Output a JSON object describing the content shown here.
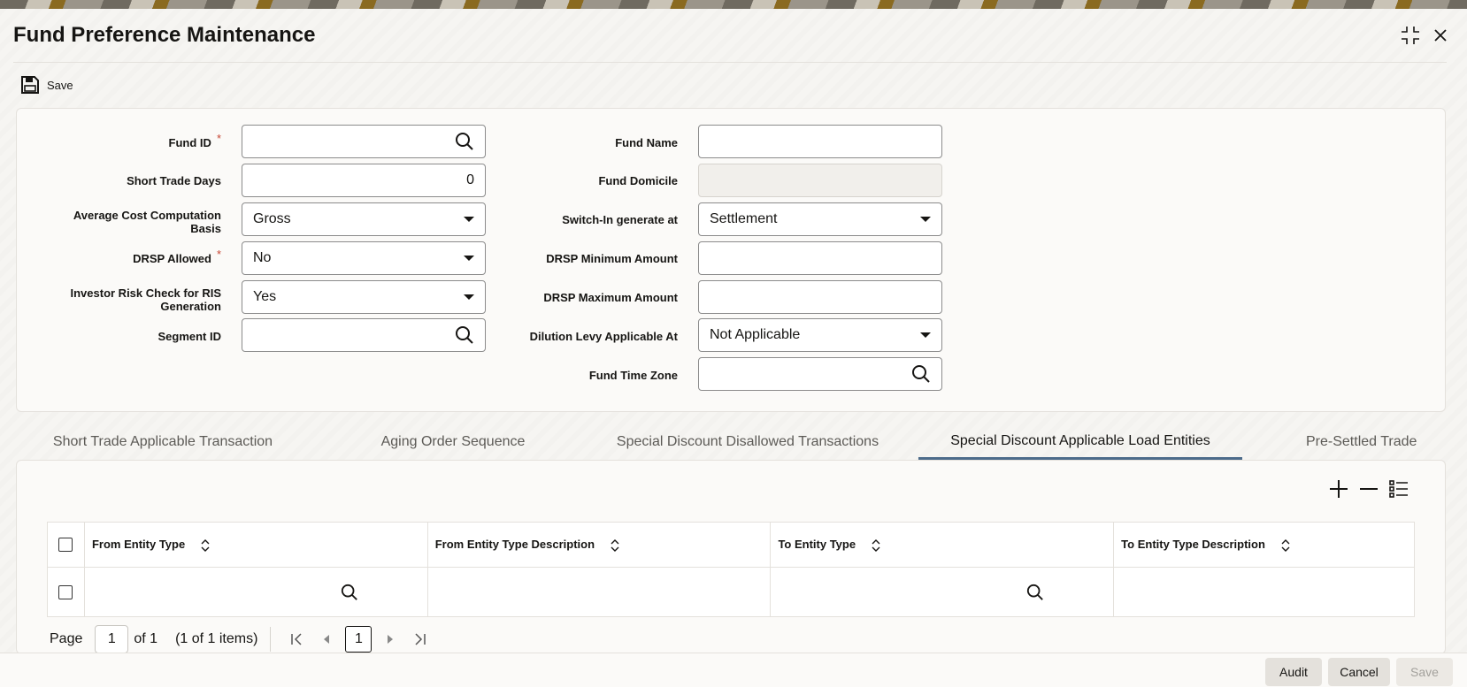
{
  "title": "Fund Preference Maintenance",
  "toolbar": {
    "save_label": "Save"
  },
  "form": {
    "fund_id": {
      "label": "Fund ID",
      "value": ""
    },
    "short_trade_days": {
      "label": "Short Trade Days",
      "value": "0"
    },
    "avg_cost_basis": {
      "label_line1": "Average Cost Computation",
      "label_line2": "Basis",
      "value": "Gross"
    },
    "drsp_allowed": {
      "label": "DRSP Allowed",
      "value": "No"
    },
    "investor_risk_check": {
      "label_line1": "Investor Risk Check for RIS",
      "label_line2": "Generation",
      "value": "Yes"
    },
    "segment_id": {
      "label": "Segment ID",
      "value": ""
    },
    "fund_name": {
      "label": "Fund Name",
      "value": ""
    },
    "fund_domicile": {
      "label": "Fund Domicile",
      "value": ""
    },
    "switch_in_generate_at": {
      "label": "Switch-In generate at",
      "value": "Settlement"
    },
    "drsp_min_amount": {
      "label": "DRSP Minimum Amount",
      "value": ""
    },
    "drsp_max_amount": {
      "label": "DRSP Maximum Amount",
      "value": ""
    },
    "dilution_levy_at": {
      "label": "Dilution Levy Applicable At",
      "value": "Not Applicable"
    },
    "fund_time_zone": {
      "label": "Fund Time Zone",
      "value": ""
    },
    "required_mark": "*"
  },
  "tabs": [
    {
      "label": "Short Trade Applicable Transaction"
    },
    {
      "label": "Aging Order Sequence"
    },
    {
      "label": "Special Discount Disallowed Transactions"
    },
    {
      "label": "Special Discount Applicable Load Entities"
    },
    {
      "label": "Pre-Settled Trade"
    }
  ],
  "active_tab": 3,
  "table": {
    "columns": [
      "From Entity Type",
      "From Entity Type Description",
      "To Entity Type",
      "To Entity Type Description"
    ],
    "rows": [
      {
        "from_entity_type": "",
        "from_entity_desc": "",
        "to_entity_type": "",
        "to_entity_desc": ""
      }
    ]
  },
  "pager": {
    "page_label": "Page",
    "page_value": "1",
    "of_label": "of 1",
    "items_label": "(1 of 1 items)",
    "current_page": "1"
  },
  "footer": {
    "audit_label": "Audit",
    "cancel_label": "Cancel",
    "save_label": "Save"
  },
  "colors": {
    "accent_underline": "#4c6b8a",
    "required": "#c74634",
    "footer_button": "#e4e1dc"
  }
}
